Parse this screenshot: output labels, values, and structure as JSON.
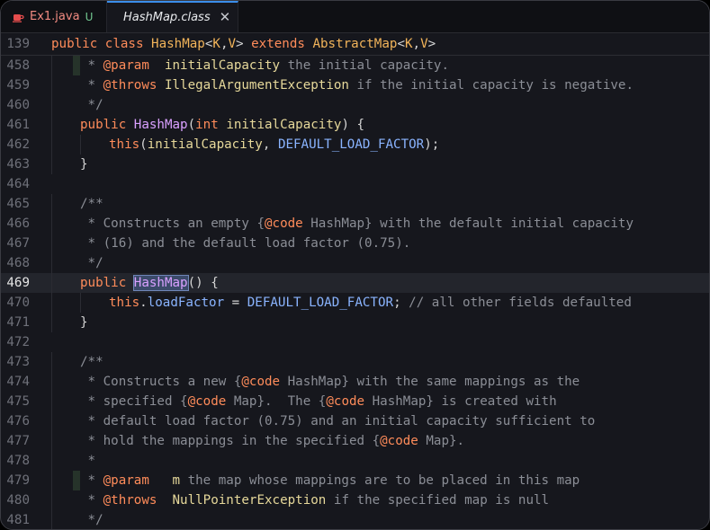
{
  "tabs": [
    {
      "name": "Ex1.java",
      "status": "U",
      "icon": "java-coffee-icon",
      "icon_color": "#e44d4d",
      "active": false
    },
    {
      "name": "HashMap.class",
      "icon": "java-coffee-icon",
      "icon_color": "#3b8eea",
      "active": true,
      "close": "✕"
    }
  ],
  "sticky": {
    "line_number": "139",
    "tokens": [
      {
        "t": "public ",
        "c": "kw"
      },
      {
        "t": "class ",
        "c": "kw"
      },
      {
        "t": "HashMap",
        "c": "cls"
      },
      {
        "t": "<",
        "c": "pn"
      },
      {
        "t": "K",
        "c": "cls"
      },
      {
        "t": ",",
        "c": "pn"
      },
      {
        "t": "V",
        "c": "cls"
      },
      {
        "t": "> ",
        "c": "pn"
      },
      {
        "t": "extends ",
        "c": "kw"
      },
      {
        "t": "AbstractMap",
        "c": "cls"
      },
      {
        "t": "<",
        "c": "pn"
      },
      {
        "t": "K",
        "c": "cls"
      },
      {
        "t": ",",
        "c": "pn"
      },
      {
        "t": "V",
        "c": "cls"
      },
      {
        "t": ">",
        "c": "pn"
      }
    ]
  },
  "current_line": "469",
  "lines": [
    {
      "n": "458",
      "ind": 1,
      "mark": true,
      "tokens": [
        {
          "t": " * ",
          "c": "com"
        },
        {
          "t": "@param",
          "c": "tag"
        },
        {
          "t": "  ",
          "c": "com"
        },
        {
          "t": "initialCapacity",
          "c": "id"
        },
        {
          "t": " the initial capacity.",
          "c": "com"
        }
      ]
    },
    {
      "n": "459",
      "ind": 1,
      "tokens": [
        {
          "t": " * ",
          "c": "com"
        },
        {
          "t": "@throws",
          "c": "tag"
        },
        {
          "t": " ",
          "c": "com"
        },
        {
          "t": "IllegalArgumentException",
          "c": "id"
        },
        {
          "t": " if the initial capacity is negative.",
          "c": "com"
        }
      ]
    },
    {
      "n": "460",
      "ind": 1,
      "tokens": [
        {
          "t": " */",
          "c": "com"
        }
      ]
    },
    {
      "n": "461",
      "ind": 1,
      "tokens": [
        {
          "t": "public ",
          "c": "kw"
        },
        {
          "t": "HashMap",
          "c": "fn"
        },
        {
          "t": "(",
          "c": "pn"
        },
        {
          "t": "int ",
          "c": "kw"
        },
        {
          "t": "initialCapacity",
          "c": "id"
        },
        {
          "t": ") {",
          "c": "pn"
        }
      ]
    },
    {
      "n": "462",
      "ind": 2,
      "tokens": [
        {
          "t": "this",
          "c": "kw"
        },
        {
          "t": "(",
          "c": "pn"
        },
        {
          "t": "initialCapacity",
          "c": "id"
        },
        {
          "t": ", ",
          "c": "pn"
        },
        {
          "t": "DEFAULT_LOAD_FACTOR",
          "c": "const"
        },
        {
          "t": ");",
          "c": "pn"
        }
      ]
    },
    {
      "n": "463",
      "ind": 1,
      "tokens": [
        {
          "t": "}",
          "c": "pn"
        }
      ]
    },
    {
      "n": "464",
      "ind": 0,
      "tokens": []
    },
    {
      "n": "465",
      "ind": 1,
      "tokens": [
        {
          "t": "/**",
          "c": "com"
        }
      ]
    },
    {
      "n": "466",
      "ind": 1,
      "tokens": [
        {
          "t": " * Constructs an empty {",
          "c": "com"
        },
        {
          "t": "@code",
          "c": "tag"
        },
        {
          "t": " HashMap} with the default initial capacity",
          "c": "com"
        }
      ]
    },
    {
      "n": "467",
      "ind": 1,
      "tokens": [
        {
          "t": " * (16) and the default load factor (0.75).",
          "c": "com"
        }
      ]
    },
    {
      "n": "468",
      "ind": 1,
      "tokens": [
        {
          "t": " */",
          "c": "com"
        }
      ]
    },
    {
      "n": "469",
      "ind": 1,
      "tokens": [
        {
          "t": "public ",
          "c": "kw"
        },
        {
          "t": "HashMap",
          "c": "ctor-hl"
        },
        {
          "t": "() {",
          "c": "pn"
        }
      ]
    },
    {
      "n": "470",
      "ind": 2,
      "tokens": [
        {
          "t": "this",
          "c": "kw"
        },
        {
          "t": ".",
          "c": "pn"
        },
        {
          "t": "loadFactor",
          "c": "const"
        },
        {
          "t": " = ",
          "c": "pn"
        },
        {
          "t": "DEFAULT_LOAD_FACTOR",
          "c": "const"
        },
        {
          "t": "; ",
          "c": "pn"
        },
        {
          "t": "// all other fields defaulted",
          "c": "com"
        }
      ]
    },
    {
      "n": "471",
      "ind": 1,
      "tokens": [
        {
          "t": "}",
          "c": "pn"
        }
      ]
    },
    {
      "n": "472",
      "ind": 0,
      "tokens": []
    },
    {
      "n": "473",
      "ind": 1,
      "tokens": [
        {
          "t": "/**",
          "c": "com"
        }
      ]
    },
    {
      "n": "474",
      "ind": 1,
      "tokens": [
        {
          "t": " * Constructs a new {",
          "c": "com"
        },
        {
          "t": "@code",
          "c": "tag"
        },
        {
          "t": " HashMap} with the same mappings as the",
          "c": "com"
        }
      ]
    },
    {
      "n": "475",
      "ind": 1,
      "tokens": [
        {
          "t": " * specified {",
          "c": "com"
        },
        {
          "t": "@code",
          "c": "tag"
        },
        {
          "t": " Map}.  The {",
          "c": "com"
        },
        {
          "t": "@code",
          "c": "tag"
        },
        {
          "t": " HashMap} is created with",
          "c": "com"
        }
      ]
    },
    {
      "n": "476",
      "ind": 1,
      "tokens": [
        {
          "t": " * default load factor (0.75) and an initial capacity sufficient to",
          "c": "com"
        }
      ]
    },
    {
      "n": "477",
      "ind": 1,
      "tokens": [
        {
          "t": " * hold the mappings in the specified {",
          "c": "com"
        },
        {
          "t": "@code",
          "c": "tag"
        },
        {
          "t": " Map}.",
          "c": "com"
        }
      ]
    },
    {
      "n": "478",
      "ind": 1,
      "tokens": [
        {
          "t": " *",
          "c": "com"
        }
      ]
    },
    {
      "n": "479",
      "ind": 1,
      "mark": true,
      "tokens": [
        {
          "t": " * ",
          "c": "com"
        },
        {
          "t": "@param",
          "c": "tag"
        },
        {
          "t": "   ",
          "c": "com"
        },
        {
          "t": "m",
          "c": "id"
        },
        {
          "t": " the map whose mappings are to be placed in this map",
          "c": "com"
        }
      ]
    },
    {
      "n": "480",
      "ind": 1,
      "tokens": [
        {
          "t": " * ",
          "c": "com"
        },
        {
          "t": "@throws",
          "c": "tag"
        },
        {
          "t": "  ",
          "c": "com"
        },
        {
          "t": "NullPointerException",
          "c": "id"
        },
        {
          "t": " if the specified map is null",
          "c": "com"
        }
      ]
    },
    {
      "n": "481",
      "ind": 1,
      "tokens": [
        {
          "t": " */",
          "c": "com"
        }
      ]
    }
  ]
}
